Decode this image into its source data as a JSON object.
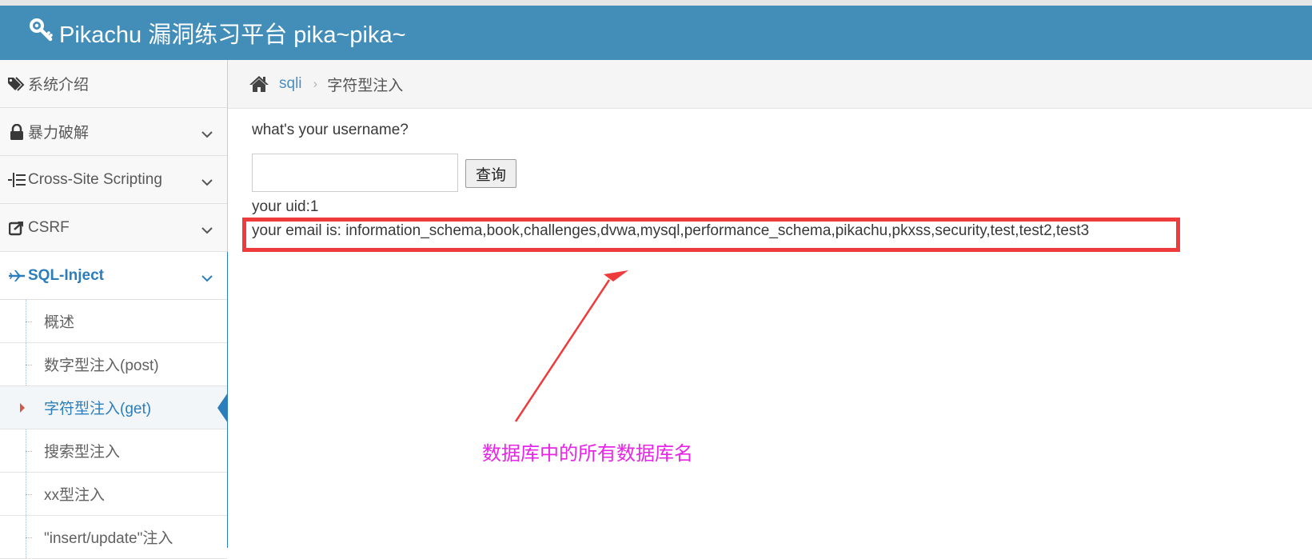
{
  "header": {
    "title": "Pikachu 漏洞练习平台 pika~pika~"
  },
  "sidebar": {
    "items": [
      {
        "label": "系统介绍",
        "icon": "tags-icon"
      },
      {
        "label": "暴力破解",
        "icon": "lock-icon"
      },
      {
        "label": "Cross-Site Scripting",
        "icon": "list-icon"
      },
      {
        "label": "CSRF",
        "icon": "share-icon"
      },
      {
        "label": "SQL-Inject",
        "icon": "plane-icon"
      }
    ],
    "sql_submenu": [
      {
        "label": "概述"
      },
      {
        "label": "数字型注入(post)"
      },
      {
        "label": "字符型注入(get)"
      },
      {
        "label": "搜索型注入"
      },
      {
        "label": "xx型注入"
      },
      {
        "label": "\"insert/update\"注入"
      }
    ]
  },
  "breadcrumb": {
    "link": "sqli",
    "current": "字符型注入"
  },
  "form": {
    "question": "what's your username?",
    "input_value": "",
    "submit_label": "查询"
  },
  "result": {
    "uid_line": "your uid:1",
    "email_line": "your email is: information_schema,book,challenges,dvwa,mysql,performance_schema,pikachu,pkxss,security,test,test2,test3"
  },
  "annotation": {
    "text": "数据库中的所有数据库名"
  },
  "colors": {
    "navbar": "#438eb9",
    "link": "#2b7dbc",
    "highlight_box": "#ee3b3b",
    "annotation_text": "#e824e8"
  }
}
